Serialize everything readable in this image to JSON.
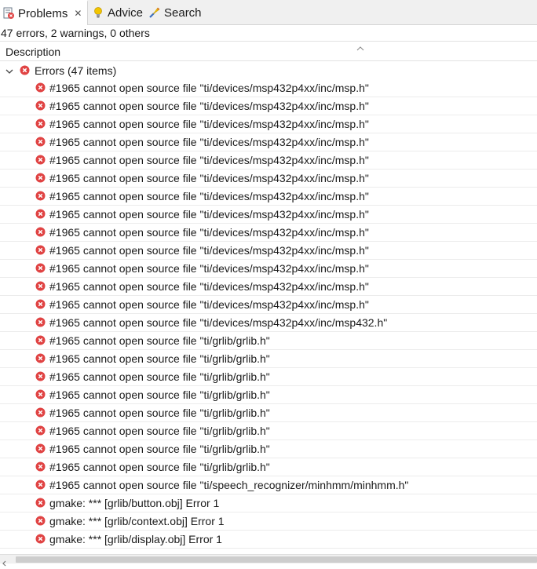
{
  "tabs": [
    {
      "label": "Problems",
      "icon": "problems-icon",
      "active": true,
      "closable": true
    },
    {
      "label": "Advice",
      "icon": "lightbulb-icon",
      "active": false
    },
    {
      "label": "Search",
      "icon": "search-icon",
      "active": false
    }
  ],
  "summary": "47 errors, 2 warnings, 0 others",
  "columns": {
    "description": "Description"
  },
  "group": {
    "label": "Errors (47 items)",
    "expanded": true
  },
  "colors": {
    "error": "#e04343",
    "accent": "#f2c500",
    "tab_bg": "#f0f0f0"
  },
  "rows": [
    {
      "text": "#1965 cannot open source file \"ti/devices/msp432p4xx/inc/msp.h\""
    },
    {
      "text": "#1965 cannot open source file \"ti/devices/msp432p4xx/inc/msp.h\""
    },
    {
      "text": "#1965 cannot open source file \"ti/devices/msp432p4xx/inc/msp.h\""
    },
    {
      "text": "#1965 cannot open source file \"ti/devices/msp432p4xx/inc/msp.h\""
    },
    {
      "text": "#1965 cannot open source file \"ti/devices/msp432p4xx/inc/msp.h\""
    },
    {
      "text": "#1965 cannot open source file \"ti/devices/msp432p4xx/inc/msp.h\""
    },
    {
      "text": "#1965 cannot open source file \"ti/devices/msp432p4xx/inc/msp.h\""
    },
    {
      "text": "#1965 cannot open source file \"ti/devices/msp432p4xx/inc/msp.h\""
    },
    {
      "text": "#1965 cannot open source file \"ti/devices/msp432p4xx/inc/msp.h\""
    },
    {
      "text": "#1965 cannot open source file \"ti/devices/msp432p4xx/inc/msp.h\""
    },
    {
      "text": "#1965 cannot open source file \"ti/devices/msp432p4xx/inc/msp.h\""
    },
    {
      "text": "#1965 cannot open source file \"ti/devices/msp432p4xx/inc/msp.h\""
    },
    {
      "text": "#1965 cannot open source file \"ti/devices/msp432p4xx/inc/msp.h\""
    },
    {
      "text": "#1965 cannot open source file \"ti/devices/msp432p4xx/inc/msp432.h\""
    },
    {
      "text": "#1965 cannot open source file \"ti/grlib/grlib.h\""
    },
    {
      "text": "#1965 cannot open source file \"ti/grlib/grlib.h\""
    },
    {
      "text": "#1965 cannot open source file \"ti/grlib/grlib.h\""
    },
    {
      "text": "#1965 cannot open source file \"ti/grlib/grlib.h\""
    },
    {
      "text": "#1965 cannot open source file \"ti/grlib/grlib.h\""
    },
    {
      "text": "#1965 cannot open source file \"ti/grlib/grlib.h\""
    },
    {
      "text": "#1965 cannot open source file \"ti/grlib/grlib.h\""
    },
    {
      "text": "#1965 cannot open source file \"ti/grlib/grlib.h\""
    },
    {
      "text": "#1965 cannot open source file \"ti/speech_recognizer/minhmm/minhmm.h\""
    },
    {
      "text": "gmake: *** [grlib/button.obj] Error 1"
    },
    {
      "text": "gmake: *** [grlib/context.obj] Error 1"
    },
    {
      "text": "gmake: *** [grlib/display.obj] Error 1"
    }
  ]
}
